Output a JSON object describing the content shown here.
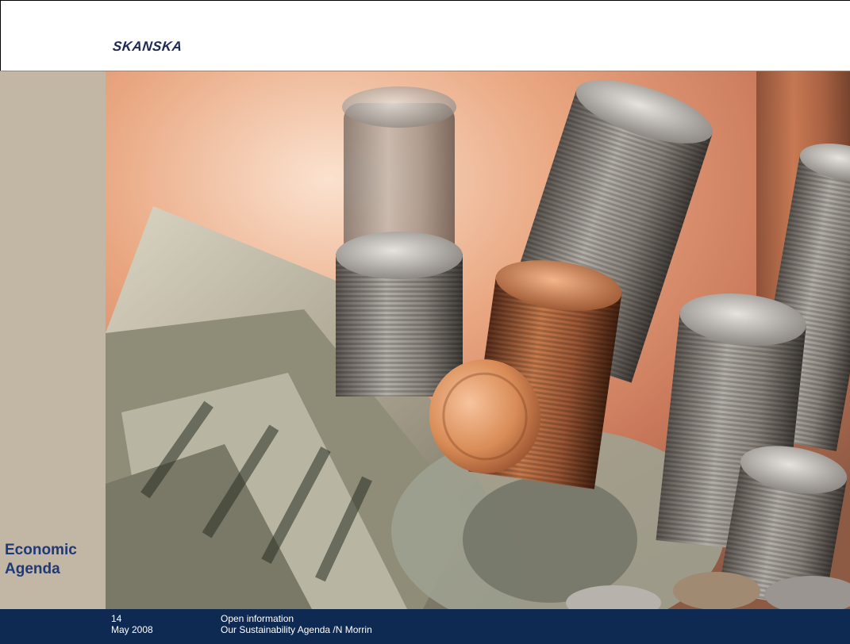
{
  "header": {
    "logo_text": "SKANSKA"
  },
  "sidebar": {
    "title_line1": "Economic",
    "title_line2": "Agenda"
  },
  "photo": {
    "subject": "stacked-coins-and-dollar-bills-photo"
  },
  "footer": {
    "page_number": "14",
    "date": "May 2008",
    "classification": "Open information",
    "presentation_title": "Our Sustainability Agenda /N Morrin"
  },
  "colors": {
    "brand_navy": "#0f2a52",
    "sidebar_tan": "#c2b6a4",
    "title_blue": "#1f3a7a"
  }
}
